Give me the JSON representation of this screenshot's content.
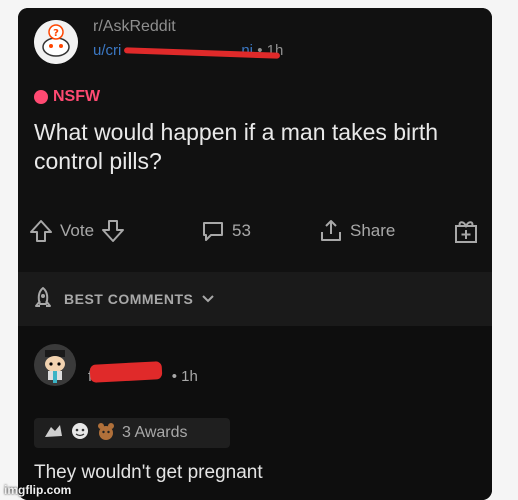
{
  "post": {
    "subreddit": "r/AskReddit",
    "username": "u/cri",
    "username_tail": "ni",
    "separator": "•",
    "time": "1h",
    "nsfw_label": "NSFW",
    "title": "What would happen if a man takes birth control pills?"
  },
  "actions": {
    "vote_label": "Vote",
    "comment_count": "53",
    "share_label": "Share"
  },
  "comments_header": {
    "sort_label": "BEST COMMENTS"
  },
  "comment": {
    "username": "fre",
    "separator": "•",
    "time": "1h",
    "awards_label": "3 Awards",
    "text": "They wouldn't get pregnant"
  },
  "watermark": "imgflip.com",
  "colors": {
    "nsfw": "#ff4a72",
    "username_link": "#3b78c4",
    "redaction": "#e02a2a"
  }
}
